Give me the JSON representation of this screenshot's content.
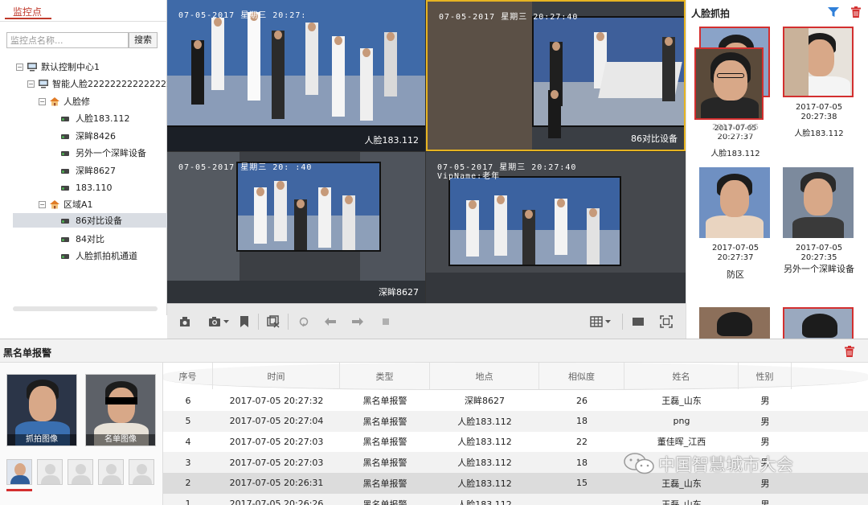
{
  "left_panel": {
    "tab": "监控点",
    "search_placeholder": "监控点名称...",
    "search_button": "搜索",
    "tree": [
      {
        "label": "默认控制中心1"
      },
      {
        "label": "智能人脸2222222222222222222"
      },
      {
        "label": "人脸修"
      },
      {
        "label": "人脸183.112"
      },
      {
        "label": "深眸8426"
      },
      {
        "label": "另外一个深眸设备"
      },
      {
        "label": "深眸8627"
      },
      {
        "label": "183.110"
      },
      {
        "label": "区域A1"
      },
      {
        "label": "86对比设备"
      },
      {
        "label": "84对比"
      },
      {
        "label": "人脸抓拍机通道"
      }
    ]
  },
  "videos": [
    {
      "osd": "07-05-2017  星期三  20:27:",
      "label": "人脸183.112"
    },
    {
      "osd": "07-05-2017  星期三  20:27:40",
      "label": "86对比设备"
    },
    {
      "osd": "07-05-2017  星期三  20:  :40",
      "label": "深眸8627"
    },
    {
      "osd": "07-05-2017  星期三  20:27:40",
      "osd2": "VipName:老年",
      "label": ""
    }
  ],
  "toolbar_icons": [
    "capture-icon",
    "camera-icon",
    "bookmark-icon",
    "multi-capture-icon",
    "refresh-icon",
    "prev-icon",
    "next-icon",
    "stop-icon",
    "grid-layout-icon",
    "single-view-icon",
    "fullscreen-icon"
  ],
  "face_panel": {
    "title": "人脸抓拍",
    "cards": [
      {
        "date": "2017-07-05",
        "time": "20:27:37",
        "name": "人脸183.112",
        "overlay_date": "2017-07-05",
        "overlay_name": "人脸183.112"
      },
      {
        "date": "2017-07-05",
        "time": "20:27:38",
        "name": "人脸183.112"
      },
      {
        "date": "2017-07-05",
        "time": "20:27:37",
        "name": "防区"
      },
      {
        "date": "2017-07-05",
        "time": "20:27:35",
        "name": "另外一个深眸设备"
      }
    ]
  },
  "alarm": {
    "title": "黑名单报警",
    "capture_label": "抓拍图像",
    "list_label": "名单图像",
    "columns": [
      "序号",
      "时间",
      "类型",
      "地点",
      "相似度",
      "姓名",
      "性别"
    ],
    "rows": [
      [
        "6",
        "2017-07-05 20:27:32",
        "黑名单报警",
        "深眸8627",
        "26",
        "王磊_山东",
        "男"
      ],
      [
        "5",
        "2017-07-05 20:27:04",
        "黑名单报警",
        "人脸183.112",
        "18",
        "png",
        "男"
      ],
      [
        "4",
        "2017-07-05 20:27:03",
        "黑名单报警",
        "人脸183.112",
        "22",
        "董佳晖_江西",
        "男"
      ],
      [
        "3",
        "2017-07-05 20:27:03",
        "黑名单报警",
        "人脸183.112",
        "18",
        "",
        "男"
      ],
      [
        "2",
        "2017-07-05 20:26:31",
        "黑名单报警",
        "人脸183.112",
        "15",
        "王磊_山东",
        "男"
      ],
      [
        "1",
        "2017-07-05 20:26:26",
        "黑名单报警",
        "人脸183.112",
        "",
        "王磊_山东",
        "男"
      ]
    ]
  },
  "watermark": "中国智慧城市大会",
  "colors": {
    "accent_red": "#c0392b",
    "filter_blue": "#2f7fd8",
    "delete_red": "#d32f2f"
  }
}
